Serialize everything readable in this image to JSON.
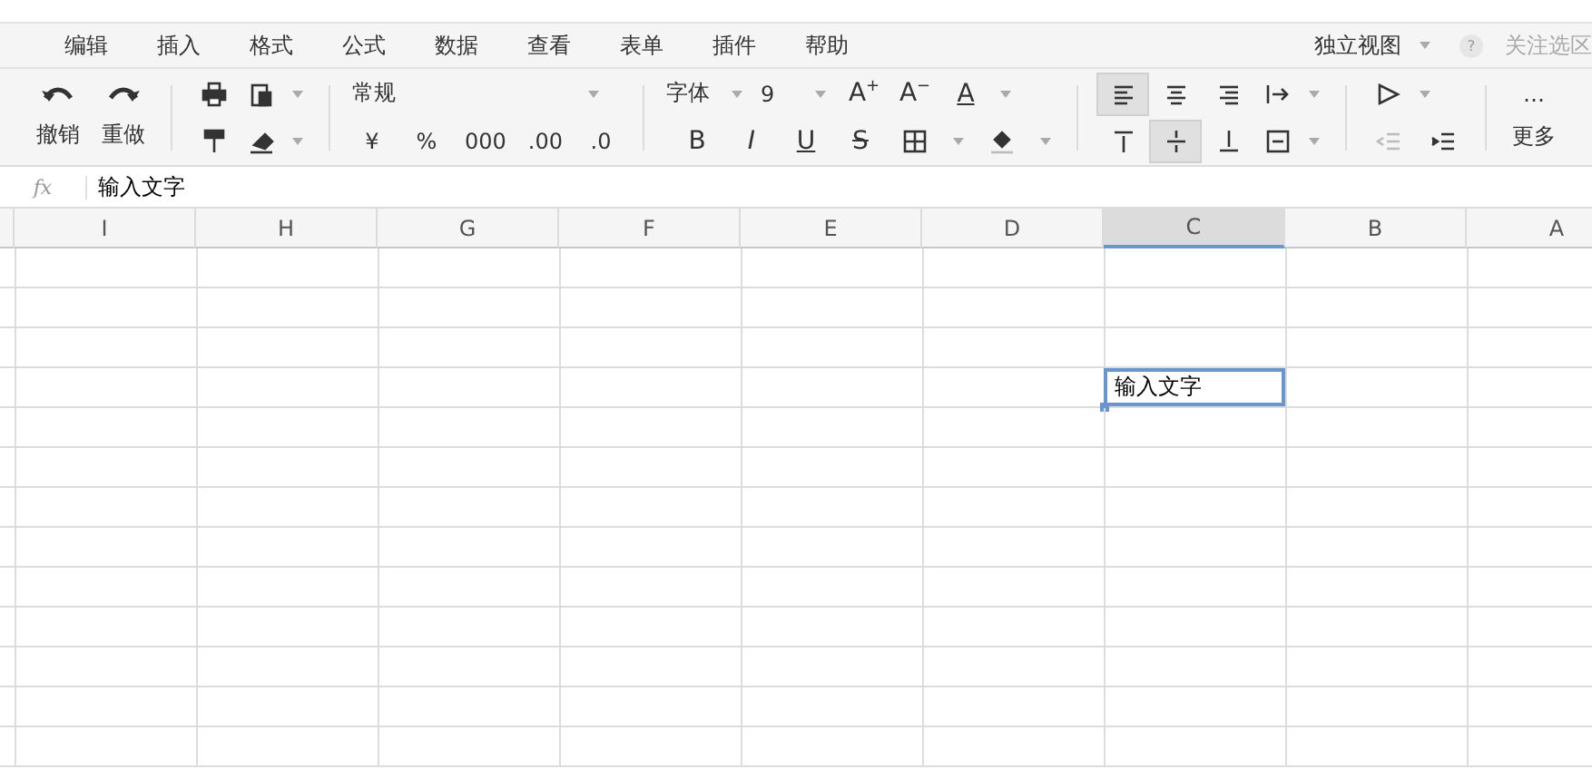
{
  "menu": {
    "items": [
      "编辑",
      "插入",
      "格式",
      "公式",
      "数据",
      "查看",
      "表单",
      "插件",
      "帮助"
    ],
    "view_label": "独立视图",
    "help": "?",
    "follow": {
      "label": "关注选区",
      "disabled": true
    }
  },
  "toolbar": {
    "undo": "撤销",
    "redo": "重做",
    "number_format": "常规",
    "currency": "¥",
    "percent": "%",
    "thousands": "000",
    "increase_decimal": ".00",
    "decrease_decimal": ".0",
    "font": "字体",
    "font_size": "9",
    "grow": "A$^{+}$",
    "shrink": "A$^{−}$",
    "font_color": "A",
    "bold": "B",
    "italic": "I",
    "underline": "U",
    "strike": "S",
    "halign": [
      {
        "selected": true
      },
      {
        "selected": false
      },
      {
        "selected": false
      }
    ],
    "valign": [
      {
        "selected": false
      },
      {
        "selected": true
      },
      {
        "selected": false
      }
    ],
    "more_icon": "…",
    "more": "更多"
  },
  "formula_bar": {
    "label": "fx",
    "value": "输入文字"
  },
  "sheet": {
    "columns": [
      {
        "label": "I",
        "selected": false
      },
      {
        "label": "H",
        "selected": false
      },
      {
        "label": "G",
        "selected": false
      },
      {
        "label": "F",
        "selected": false
      },
      {
        "label": "E",
        "selected": false
      },
      {
        "label": "D",
        "selected": false
      },
      {
        "label": "C",
        "selected": true
      },
      {
        "label": "B",
        "selected": false
      },
      {
        "label": "A",
        "selected": false
      }
    ],
    "rows": [
      {
        "selected": false
      },
      {
        "selected": false
      },
      {
        "selected": false
      },
      {
        "selected": true
      },
      {
        "selected": false
      },
      {
        "selected": false
      },
      {
        "selected": false
      },
      {
        "selected": false
      },
      {
        "selected": false
      },
      {
        "selected": false
      },
      {
        "selected": false
      },
      {
        "selected": false
      },
      {
        "selected": false
      }
    ],
    "active_cell": {
      "value": "输入文字"
    }
  }
}
